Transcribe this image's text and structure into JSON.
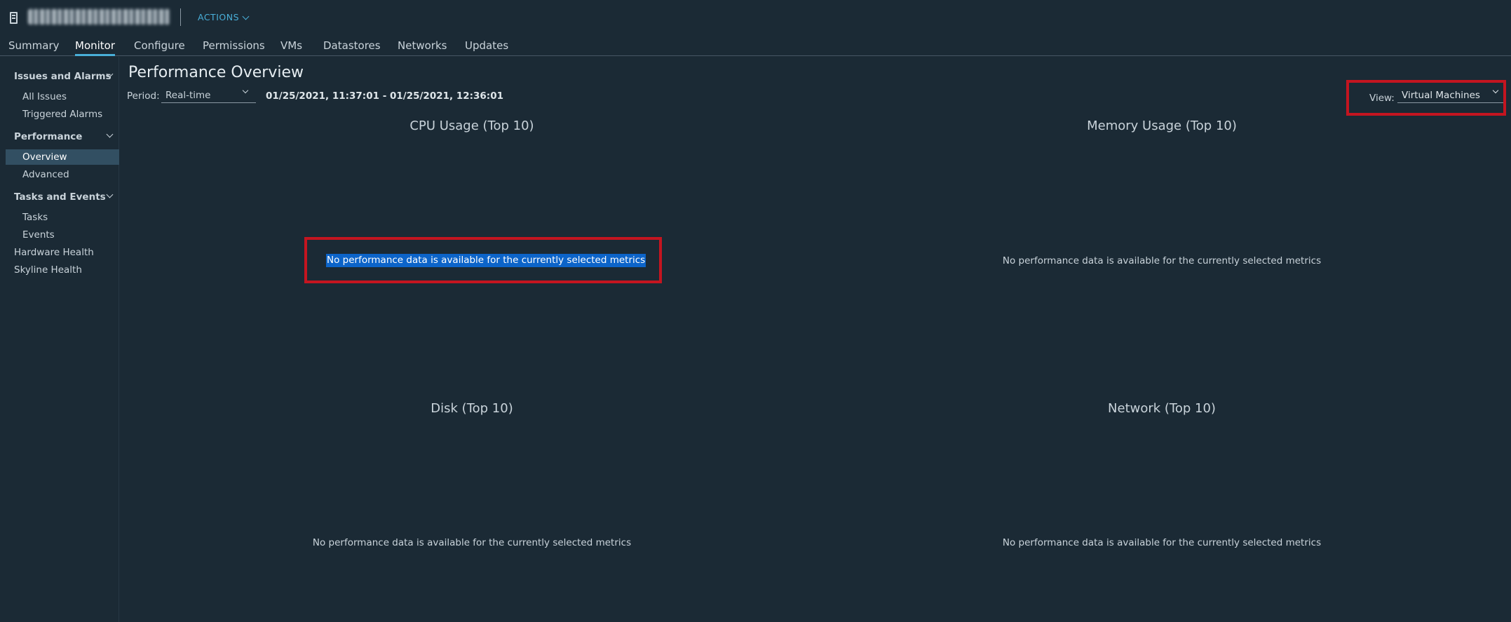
{
  "header": {
    "host_name": "obfuscated-host-name",
    "actions_label": "ACTIONS"
  },
  "tabs": [
    {
      "label": "Summary"
    },
    {
      "label": "Monitor",
      "active": true
    },
    {
      "label": "Configure"
    },
    {
      "label": "Permissions"
    },
    {
      "label": "VMs"
    },
    {
      "label": "Datastores"
    },
    {
      "label": "Networks"
    },
    {
      "label": "Updates"
    }
  ],
  "sidebar": {
    "issues_group": "Issues and Alarms",
    "all_issues": "All Issues",
    "triggered_alarms": "Triggered Alarms",
    "performance_group": "Performance",
    "overview": "Overview",
    "advanced": "Advanced",
    "tasks_group": "Tasks and Events",
    "tasks": "Tasks",
    "events": "Events",
    "hardware_health": "Hardware Health",
    "skyline_health": "Skyline Health"
  },
  "main": {
    "title": "Performance Overview",
    "period_label": "Period:",
    "period_value": "Real-time",
    "date_range": "01/25/2021, 11:37:01 - 01/25/2021, 12:36:01",
    "view_label": "View:",
    "view_value": "Virtual Machines",
    "charts": {
      "cpu": {
        "title": "CPU Usage (Top 10)",
        "message": "No performance data is available for the currently selected metrics"
      },
      "memory": {
        "title": "Memory Usage (Top 10)",
        "message": "No performance data is available for the currently selected metrics"
      },
      "disk": {
        "title": "Disk (Top 10)",
        "message": "No performance data is available for the currently selected metrics"
      },
      "network": {
        "title": "Network (Top 10)",
        "message": "No performance data is available for the currently selected metrics"
      }
    }
  },
  "colors": {
    "background": "#1b2a35",
    "accent": "#49afd9",
    "highlight_border": "#c41520",
    "selection": "#0c64c9"
  }
}
